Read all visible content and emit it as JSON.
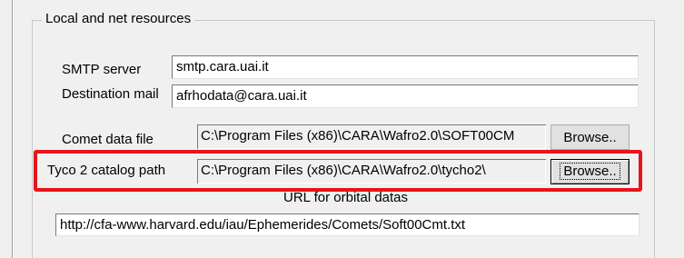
{
  "group": {
    "legend": "Local and net resources"
  },
  "smtp": {
    "label": "SMTP server",
    "value": "smtp.cara.uai.it"
  },
  "destination": {
    "label": "Destination mail",
    "value": "afrhodata@cara.uai.it"
  },
  "comet": {
    "label": "Comet data file",
    "value": "C:\\Program Files (x86)\\CARA\\Wafro2.0\\SOFT00CM",
    "browse_label": "Browse.."
  },
  "tyco": {
    "label": "Tyco 2  catalog path",
    "value": "C:\\Program Files (x86)\\CARA\\Wafro2.0\\tycho2\\",
    "browse_label": "Browse.."
  },
  "orbital": {
    "label": "URL for orbital datas",
    "value": "http://cfa-www.harvard.edu/iau/Ephemerides/Comets/Soft00Cmt.txt"
  },
  "colors": {
    "highlight": "#e8141a",
    "background": "#f0f0f0"
  }
}
